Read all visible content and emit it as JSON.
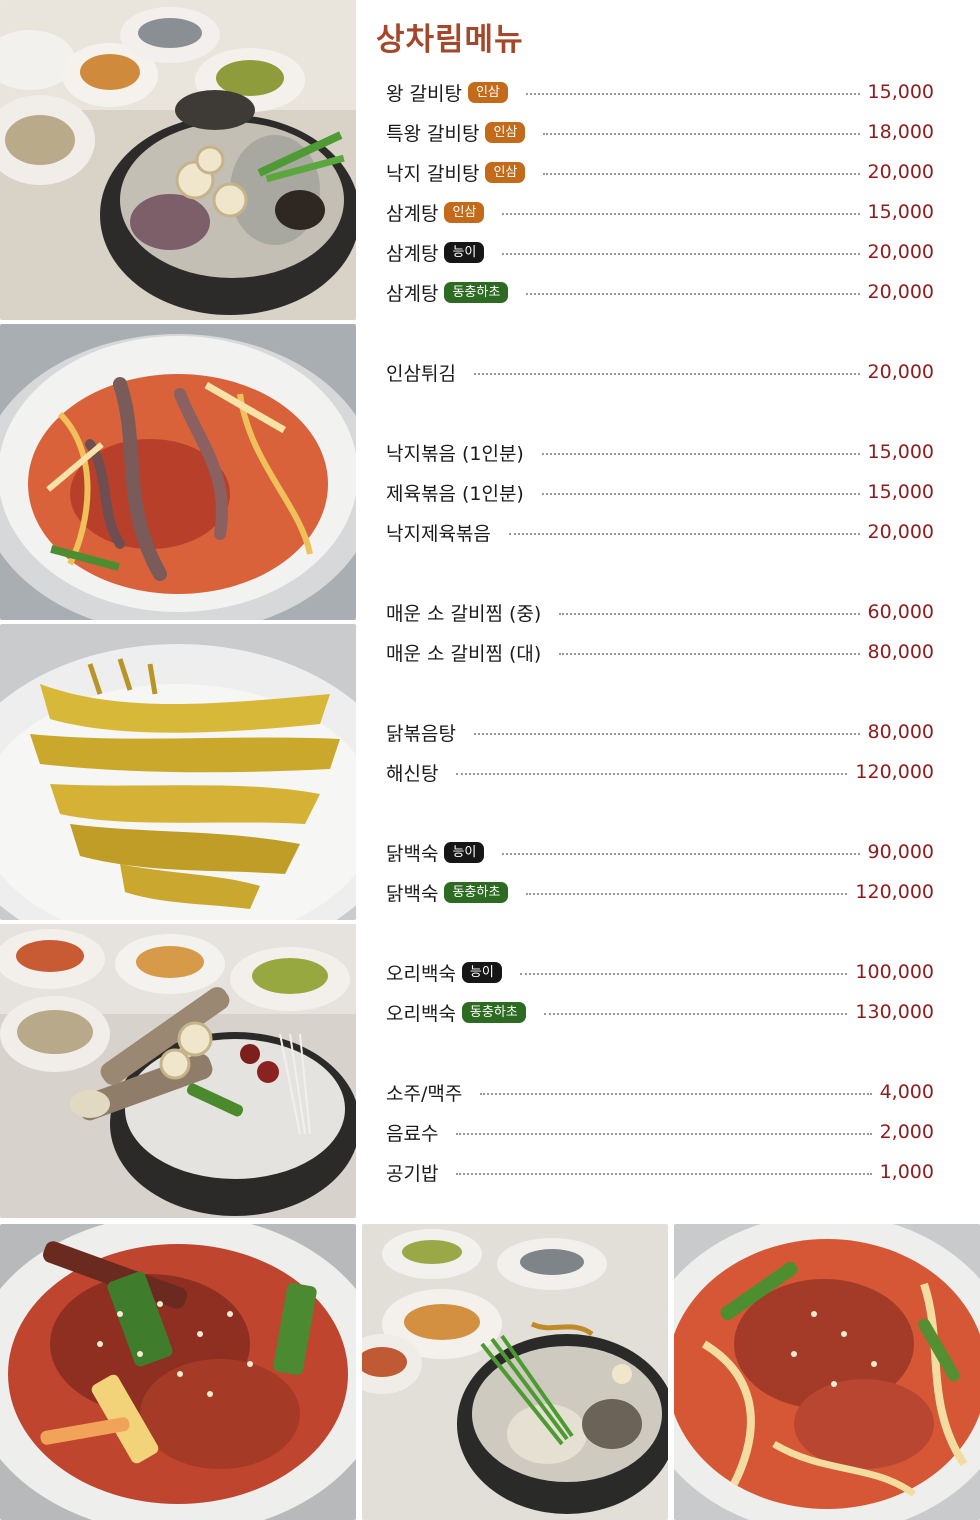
{
  "title": "상차림메뉴",
  "badge_colors": {
    "인삼": "#c36a1b",
    "능이": "#161616",
    "동충하초": "#2c6b21"
  },
  "colors": {
    "title": "#a5472a",
    "price": "#8e1c1c",
    "text": "#1b1b1b"
  },
  "menu": [
    {
      "name": "왕 갈비탕",
      "badge": "인삼",
      "price": "15,000"
    },
    {
      "name": "특왕 갈비탕",
      "badge": "인삼",
      "price": "18,000"
    },
    {
      "name": "낙지 갈비탕",
      "badge": "인삼",
      "price": "20,000"
    },
    {
      "name": "삼계탕",
      "badge": "인삼",
      "price": "15,000"
    },
    {
      "name": "삼계탕",
      "badge": "능이",
      "price": "20,000"
    },
    {
      "name": "삼계탕",
      "badge": "동충하초",
      "price": "20,000"
    },
    {
      "name": "인삼튀김",
      "badge": "",
      "price": "20,000"
    },
    {
      "name": "낙지볶음 (1인분)",
      "badge": "",
      "price": "15,000"
    },
    {
      "name": "제육볶음 (1인분)",
      "badge": "",
      "price": "15,000"
    },
    {
      "name": "낙지제육볶음",
      "badge": "",
      "price": "20,000"
    },
    {
      "name": "매운 소 갈비찜 (중)",
      "badge": "",
      "price": "60,000"
    },
    {
      "name": "매운 소 갈비찜 (대)",
      "badge": "",
      "price": "80,000"
    },
    {
      "name": "닭볶음탕",
      "badge": "",
      "price": "80,000"
    },
    {
      "name": "해신탕",
      "badge": "",
      "price": "120,000"
    },
    {
      "name": "닭백숙",
      "badge": "능이",
      "price": "90,000"
    },
    {
      "name": "닭백숙",
      "badge": "동충하초",
      "price": "120,000"
    },
    {
      "name": "오리백숙",
      "badge": "능이",
      "price": "100,000"
    },
    {
      "name": "오리백숙",
      "badge": "동충하초",
      "price": "130,000"
    },
    {
      "name": "소주/맥주",
      "badge": "",
      "price": "4,000"
    },
    {
      "name": "음료수",
      "badge": "",
      "price": "2,000"
    },
    {
      "name": "공기밥",
      "badge": "",
      "price": "1,000"
    }
  ],
  "photos": [
    {
      "icon": "ginseng-galbitang-photo"
    },
    {
      "icon": "spicy-octopus-stirfry-photo"
    },
    {
      "icon": "ginseng-tempura-photo"
    },
    {
      "icon": "galbitang-with-glass-noodles-photo"
    },
    {
      "icon": "spicy-braised-ribs-photo"
    },
    {
      "icon": "samgyetang-with-sides-photo"
    },
    {
      "icon": "jeyuk-bokkeum-photo"
    }
  ]
}
